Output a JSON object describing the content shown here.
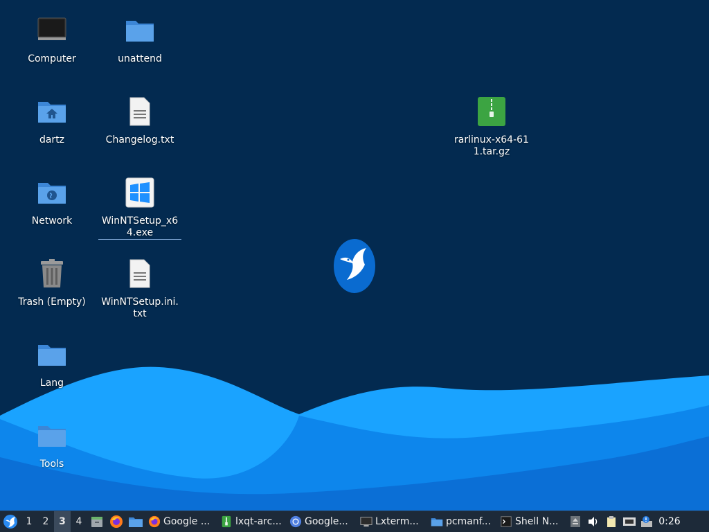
{
  "desktop": {
    "icons": [
      {
        "label": "Computer"
      },
      {
        "label": "unattend"
      },
      {
        "label": "dartz"
      },
      {
        "label": "Changelog.txt"
      },
      {
        "label": "rarlinux-x64-611.tar.gz"
      },
      {
        "label": "Network"
      },
      {
        "label": "WinNTSetup_x64.exe"
      },
      {
        "label": "Trash (Empty)"
      },
      {
        "label": "WinNTSetup.ini.txt"
      },
      {
        "label": "Lang"
      },
      {
        "label": "Tools"
      }
    ]
  },
  "taskbar": {
    "workspaces": [
      "1",
      "2",
      "3",
      "4"
    ],
    "active_workspace": "3",
    "tasks": [
      {
        "label": "Google ...",
        "icon": "firefox-icon"
      },
      {
        "label": "lxqt-arc...",
        "icon": "archive-icon"
      },
      {
        "label": "Google...",
        "icon": "chromium-icon"
      },
      {
        "label": "Lxterm...",
        "icon": "terminal-icon"
      },
      {
        "label": "pcmanf...",
        "icon": "folder-icon"
      },
      {
        "label": "Shell N...",
        "icon": "shell-icon"
      }
    ],
    "clock": "0:26"
  },
  "colors": {
    "background": "#032a50",
    "wave_light": "#1aa3ff",
    "wave_mid": "#0b79e0",
    "taskbar": "#1d2a39"
  }
}
